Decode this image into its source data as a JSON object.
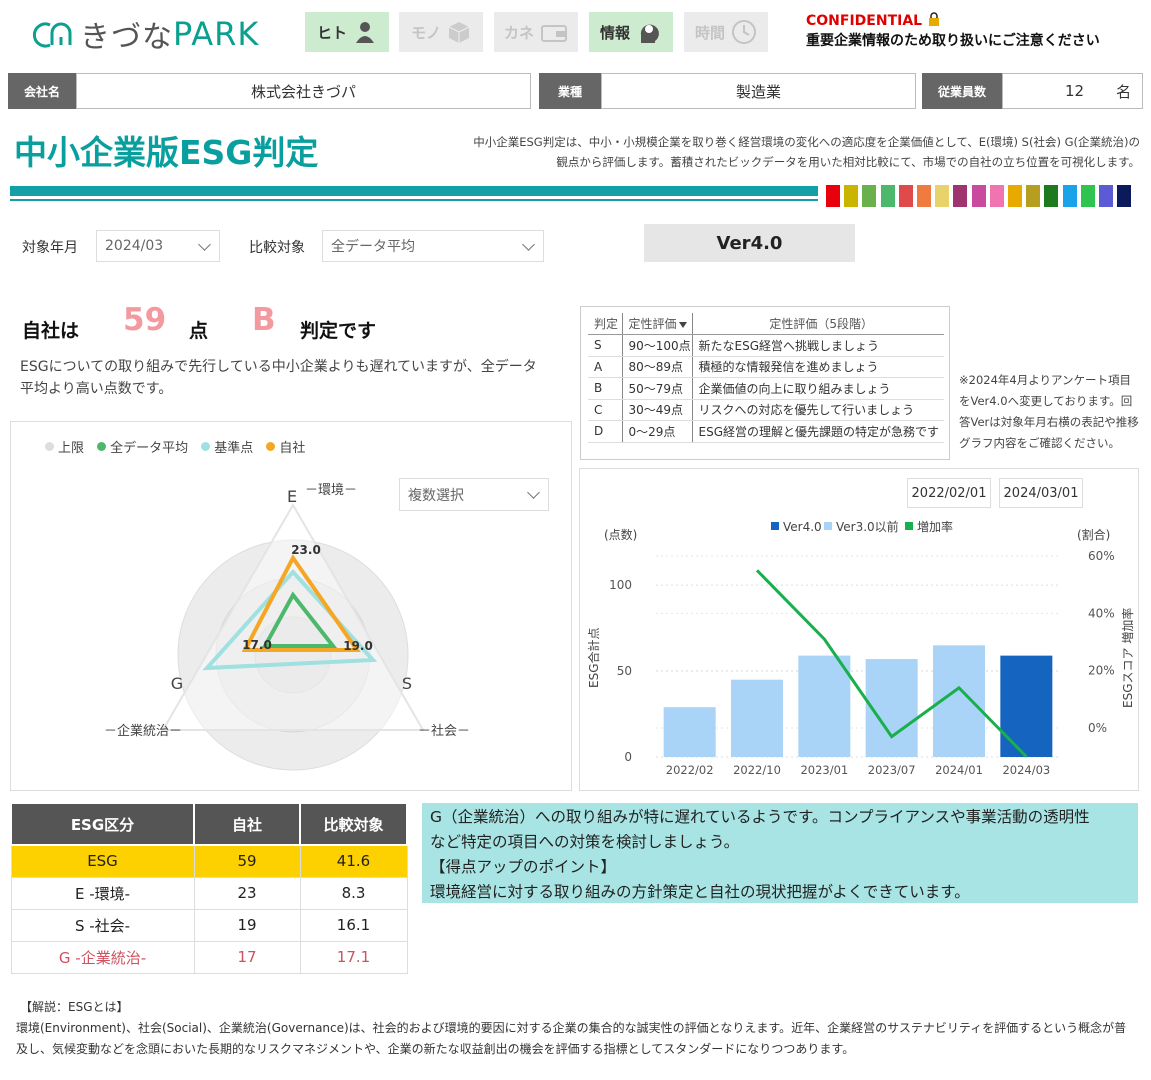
{
  "header": {
    "logo_part1": "きづな",
    "logo_part2": "PARK",
    "nav": [
      {
        "label": "ヒト",
        "icon": "person-icon",
        "state": "on"
      },
      {
        "label": "モノ",
        "icon": "box-icon",
        "state": "off"
      },
      {
        "label": "カネ",
        "icon": "wallet-icon",
        "state": "off"
      },
      {
        "label": "情報",
        "icon": "head-brain-icon",
        "state": "on"
      },
      {
        "label": "時間",
        "icon": "clock-icon",
        "state": "off"
      }
    ],
    "confidential": "CONFIDENTIAL",
    "confidential_note": "重要企業情報のため取り扱いにご注意ください"
  },
  "company": {
    "name_label": "会社名",
    "name": "株式会社きづパ",
    "industry_label": "業種",
    "industry": "製造業",
    "employees_label": "従業員数",
    "employees": "12",
    "employees_unit": "名"
  },
  "title": "中小企業版ESG判定",
  "description_1": "中小企業ESG判定は、中小・小規模企業を取り巻く経営環境の変化への適応度を企業価値として、E(環境) S(社会) G(企業統治)の",
  "description_2": "観点から評価します。蓄積されたビックデータを用いた相対比較にて、市場での自社の立ち位置を可視化します。",
  "swatch_colors": [
    "#e8000d",
    "#c9b400",
    "#6ab04c",
    "#4cb86c",
    "#e04a4a",
    "#f07b3f",
    "#e8d36a",
    "#a0346e",
    "#c84b9e",
    "#f074b0",
    "#e8a900",
    "#b59e20",
    "#1f7a1f",
    "#1aa3e8",
    "#2ec44f",
    "#5d5ad6",
    "#0a1a5a"
  ],
  "filters": {
    "month_label": "対象年月",
    "month_value": "2024/03",
    "compare_label": "比較対象",
    "compare_value": "全データ平均",
    "version": "Ver4.0"
  },
  "result": {
    "prefix": "自社は",
    "score": "59",
    "score_unit": "点",
    "grade": "B",
    "suffix": "判定です",
    "description": "ESGについての取り組みで先行している中小企業よりも遅れていますが、全データ平均より高い点数です。"
  },
  "grade_table": {
    "headers": [
      "判定",
      "定性評価",
      "定性評価（5段階）"
    ],
    "rows": [
      [
        "S",
        "90〜100点",
        "新たなESG経営へ挑戦しましょう"
      ],
      [
        "A",
        "80〜89点",
        "積極的な情報発信を進めましょう"
      ],
      [
        "B",
        "50〜79点",
        "企業価値の向上に取り組みましょう"
      ],
      [
        "C",
        "30〜49点",
        "リスクへの対応を優先して行いましょう"
      ],
      [
        "D",
        "0〜29点",
        "ESG経営の理解と優先課題の特定が急務です"
      ]
    ]
  },
  "note": "※2024年4月よりアンケート項目をVer4.0へ変更しております。回答Verは対象年月右横の表記や推移グラフ内容をご確認ください。",
  "radar": {
    "legend": [
      {
        "name": "上限",
        "color": "#dddddd"
      },
      {
        "name": "全データ平均",
        "color": "#4cb86c"
      },
      {
        "name": "基準点",
        "color": "#9fe0e0"
      },
      {
        "name": "自社",
        "color": "#f5a623"
      }
    ],
    "multi_select": "複数選択",
    "axis_e": "E",
    "axis_s": "S",
    "axis_g": "G",
    "label_e": "－環境－",
    "label_s": "－社会－",
    "label_g": "－企業統治－",
    "value_e": "23.0",
    "value_s": "19.0",
    "value_g": "17.0"
  },
  "chart_data": {
    "type": "bar",
    "categories": [
      "2022/02",
      "2022/10",
      "2023/01",
      "2023/07",
      "2024/01",
      "2024/03"
    ],
    "series": [
      {
        "name": "Ver4.0",
        "color": "#1565c0",
        "values": [
          null,
          null,
          null,
          null,
          null,
          59
        ]
      },
      {
        "name": "Ver3.0以前",
        "color": "#a9d4f7",
        "values": [
          29,
          45,
          59,
          57,
          65,
          null
        ]
      },
      {
        "name": "増加率",
        "color": "#19b04c",
        "type": "line",
        "axis": "right",
        "values": [
          null,
          55,
          31,
          -3,
          14,
          -10
        ]
      }
    ],
    "ylabel": "ESG合計点",
    "ylabel_unit": "(点数)",
    "y2label": "ESGスコア 増加率",
    "y2label_unit": "(割合)",
    "yticks": [
      "0",
      "50",
      "100"
    ],
    "y2ticks": [
      "0%",
      "20%",
      "40%",
      "60%"
    ],
    "ylim": [
      0,
      110
    ],
    "y2lim": [
      -10,
      60
    ],
    "date_from": "2022/02/01",
    "date_to": "2024/03/01"
  },
  "score_table": {
    "headers": [
      "ESG区分",
      "自社",
      "比較対象"
    ],
    "rows": [
      [
        "ESG",
        "59",
        "41.6"
      ],
      [
        "E -環境-",
        "23",
        "8.3"
      ],
      [
        "S -社会-",
        "19",
        "16.1"
      ],
      [
        "G -企業統治-",
        "17",
        "17.1"
      ]
    ]
  },
  "advice": {
    "line1": "G（企業統治）への取り組みが特に遅れているようです。コンプライアンスや事業活動の透明性",
    "line2": "など特定の項目への対策を検討しましょう。",
    "line3": "【得点アップのポイント】",
    "line4": "環境経営に対する取り組みの方針策定と自社の現状把握がよくできています。"
  },
  "explain": {
    "heading": "【解説：ESGとは】",
    "text": "環境(Environment)、社会(Social)、企業統治(Governance)は、社会的および環境的要因に対する企業の集合的な誠実性の評価となりえます。近年、企業経営のサステナビリティを評価するという概念が普及し、気候変動などを念頭においた長期的なリスクマネジメントや、企業の新たな収益創出の機会を評価する指標としてスタンダードになりつつあります。"
  }
}
